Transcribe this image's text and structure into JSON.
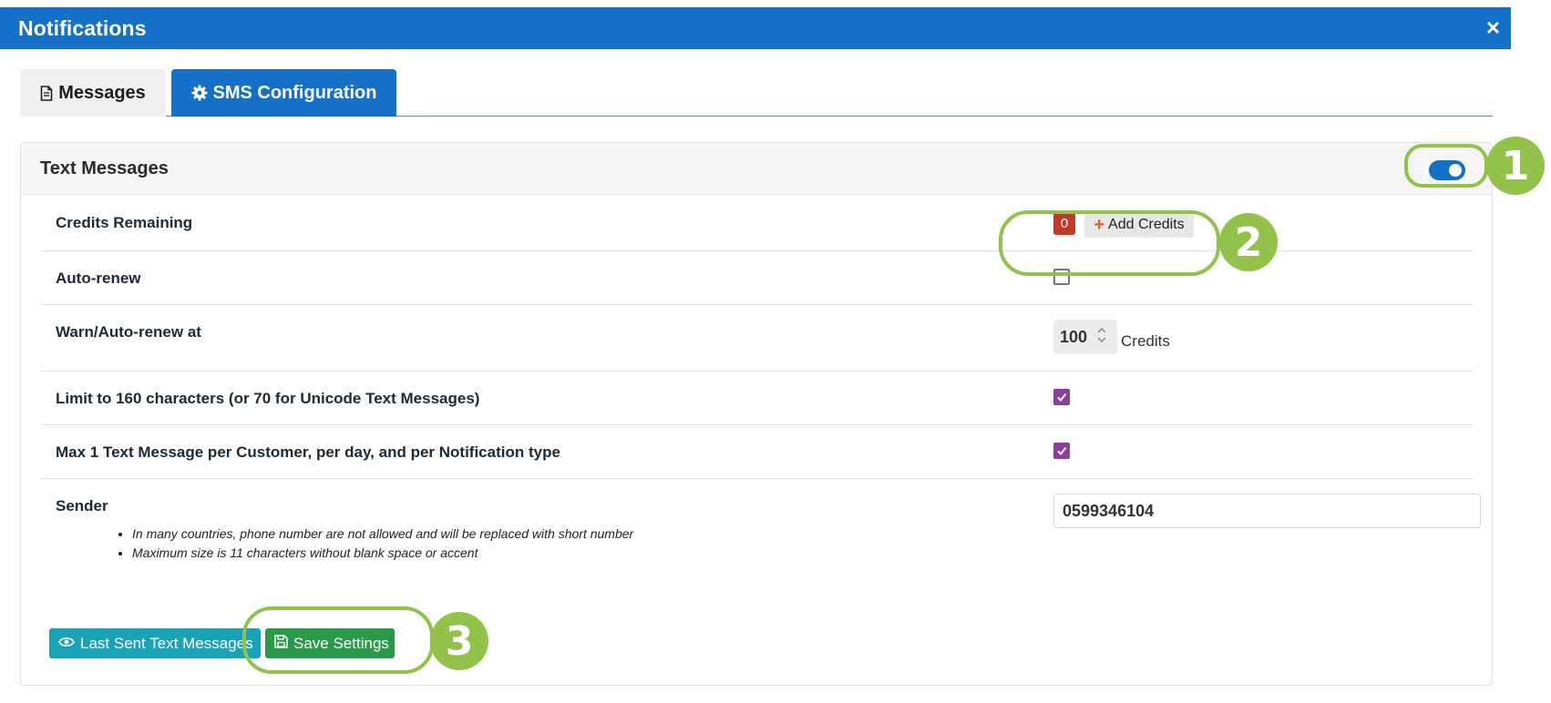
{
  "modal": {
    "title": "Notifications",
    "close_glyph": "×"
  },
  "tabs": [
    {
      "label": "Messages",
      "icon": "document-icon",
      "active": false
    },
    {
      "label": "SMS Configuration",
      "icon": "gear-icon",
      "active": true
    }
  ],
  "panel": {
    "title": "Text Messages",
    "enabled": true
  },
  "rows": {
    "credits": {
      "label": "Credits Remaining",
      "value": "0",
      "add_label": "Add Credits"
    },
    "auto_renew": {
      "label": "Auto-renew",
      "checked": false
    },
    "warn": {
      "label": "Warn/Auto-renew at",
      "value": "100",
      "unit": "Credits"
    },
    "limit": {
      "label": "Limit to 160 characters (or 70 for Unicode Text Messages)",
      "checked": true
    },
    "max": {
      "label": "Max 1 Text Message per Customer, per day, and per Notification type",
      "checked": true
    },
    "sender": {
      "label": "Sender",
      "value": "0599346104",
      "notes": [
        "In many countries, phone number are not allowed and will be replaced with short number",
        "Maximum size is 11 characters without blank space or accent"
      ]
    }
  },
  "buttons": {
    "last_sent": "Last Sent Text Messages",
    "save": "Save Settings"
  },
  "callouts": [
    "1",
    "2",
    "3"
  ],
  "colors": {
    "primary": "#1570c8",
    "checkbox": "#8a3f9a",
    "badge": "#c0392b",
    "teal": "#1aa3b7",
    "green": "#2a9a48",
    "callout": "#93c24a"
  }
}
